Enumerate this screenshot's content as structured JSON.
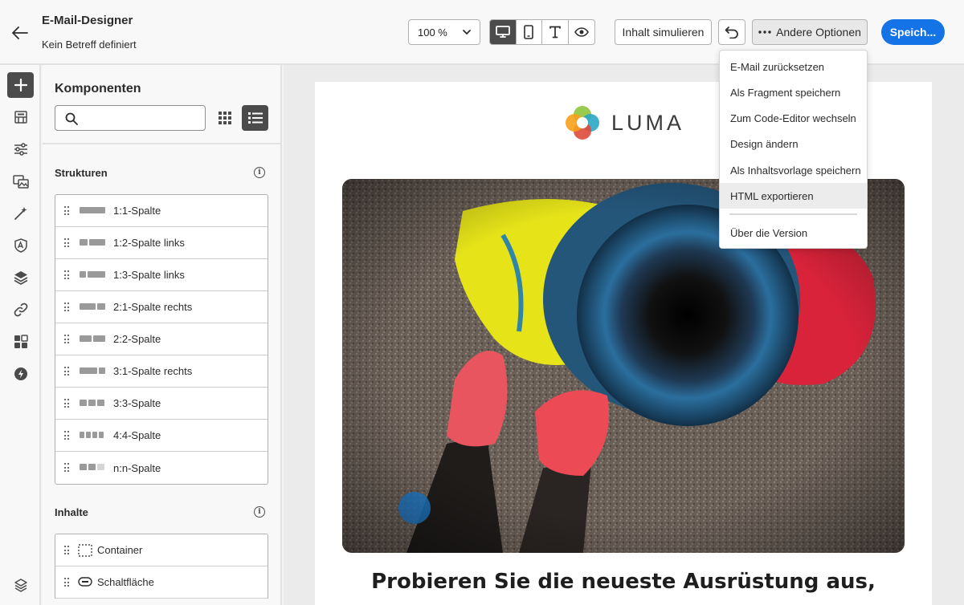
{
  "header": {
    "title": "E-Mail-Designer",
    "subject": "Kein Betreff definiert",
    "zoom": "100 %",
    "simulate_label": "Inhalt simulieren",
    "more_label": "Andere Optionen",
    "save_label": "Speich...",
    "view_modes": [
      "desktop-icon",
      "mobile-icon",
      "text-icon",
      "eye-icon"
    ],
    "selected_view": "desktop"
  },
  "menu": {
    "items": [
      "E-Mail zurücksetzen",
      "Als Fragment speichern",
      "Zum Code-Editor wechseln",
      "Design ändern",
      "Als Inhaltsvorlage speichern",
      "HTML exportieren"
    ],
    "footer_item": "Über die Version",
    "hovered": "HTML exportieren"
  },
  "panel": {
    "title": "Komponenten",
    "search_placeholder": "",
    "structures_title": "Strukturen",
    "structures": [
      "1:1-Spalte",
      "1:2-Spalte links",
      "1:3-Spalte links",
      "2:1-Spalte rechts",
      "2:2-Spalte",
      "3:1-Spalte rechts",
      "3:3-Spalte",
      "4:4-Spalte",
      "n:n-Spalte"
    ],
    "contents_title": "Inhalte",
    "contents": [
      "Container",
      "Schaltfläche"
    ]
  },
  "canvas": {
    "logo_text": "LUMA",
    "headline": "Probieren Sie die neueste Ausrüstung aus,"
  },
  "colors": {
    "accent": "#1473e6",
    "selected": "#4b4b4b",
    "logo": [
      "#f6a01a",
      "#e04b3b",
      "#2aa6c6",
      "#8fc43d"
    ]
  }
}
